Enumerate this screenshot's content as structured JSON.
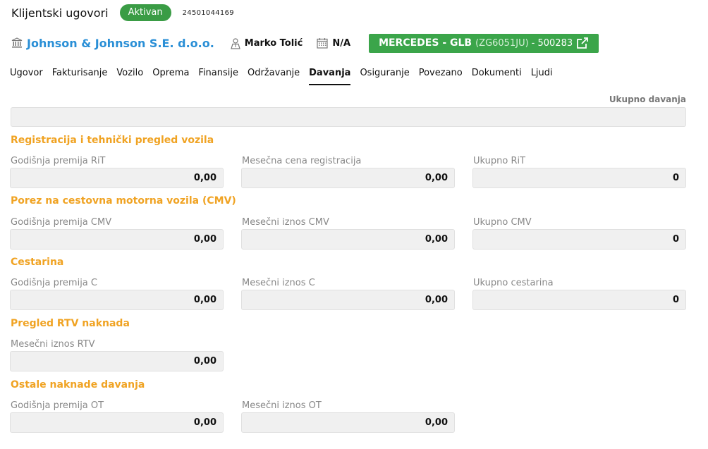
{
  "header": {
    "title": "Klijentski ugovori",
    "status": "Aktivan",
    "contract_number": "24501044169"
  },
  "info": {
    "client": "Johnson & Johnson S.E. d.o.o.",
    "person": "Marko Tolić",
    "date": "N/A",
    "vehicle": {
      "model": "MERCEDES - GLB",
      "plate": "(ZG6051JU)",
      "id": "- 500283"
    }
  },
  "tabs": [
    "Ugovor",
    "Fakturisanje",
    "Vozilo",
    "Oprema",
    "Finansije",
    "Održavanje",
    "Davanja",
    "Osiguranje",
    "Povezano",
    "Dokumenti",
    "Ljudi"
  ],
  "active_tab": "Davanja",
  "total": {
    "label": "Ukupno davanja",
    "value": ""
  },
  "sections": {
    "rit": {
      "title": "Registracija i tehnički pregled vozila",
      "fields": [
        {
          "label": "Godišnja premija RiT",
          "value": "0,00"
        },
        {
          "label": "Mesečna cena registracija",
          "value": "0,00"
        },
        {
          "label": "Ukupno RiT",
          "value": "0"
        }
      ]
    },
    "cmv": {
      "title": "Porez na cestovna motorna vozila (CMV)",
      "fields": [
        {
          "label": "Godišnja premija CMV",
          "value": "0,00"
        },
        {
          "label": "Mesečni iznos CMV",
          "value": "0,00"
        },
        {
          "label": "Ukupno CMV",
          "value": "0"
        }
      ]
    },
    "cestarina": {
      "title": "Cestarina",
      "fields": [
        {
          "label": "Godišnja premija C",
          "value": "0,00"
        },
        {
          "label": "Mesečni iznos C",
          "value": "0,00"
        },
        {
          "label": "Ukupno cestarina",
          "value": "0"
        }
      ]
    },
    "rtv": {
      "title": "Pregled RTV naknada",
      "fields": [
        {
          "label": "Mesečni iznos RTV",
          "value": "0,00"
        }
      ]
    },
    "ot": {
      "title": "Ostale naknade davanja",
      "fields": [
        {
          "label": "Godišnja premija OT",
          "value": "0,00"
        },
        {
          "label": "Mesečni iznos OT",
          "value": "0,00"
        }
      ]
    }
  },
  "colors": {
    "accent_orange": "#f0a323",
    "brand_blue": "#2a8fd6",
    "status_green": "#3a9c45",
    "vehicle_green": "#3ba54a"
  }
}
